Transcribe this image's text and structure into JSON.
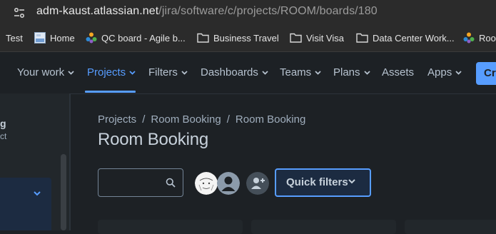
{
  "browser": {
    "url_domain": "adm-kaust.atlassian.net",
    "url_path": "/jira/software/c/projects/ROOM/boards/180",
    "bookmarks": [
      {
        "label": "Test",
        "icon": "none"
      },
      {
        "label": "Home",
        "icon": "page-thumbnail-icon"
      },
      {
        "label": "QC board - Agile b...",
        "icon": "jira-icon"
      },
      {
        "label": "Business Travel",
        "icon": "folder-icon"
      },
      {
        "label": "Visit Visa",
        "icon": "folder-icon"
      },
      {
        "label": "Data Center Work...",
        "icon": "folder-icon"
      },
      {
        "label": "Roo",
        "icon": "jira-icon"
      }
    ]
  },
  "nav": {
    "items": [
      {
        "label": "Your work"
      },
      {
        "label": "Projects"
      },
      {
        "label": "Filters"
      },
      {
        "label": "Dashboards"
      },
      {
        "label": "Teams"
      },
      {
        "label": "Plans"
      },
      {
        "label": "Assets"
      },
      {
        "label": "Apps"
      }
    ],
    "active": "Projects",
    "create_label": "Cr"
  },
  "sidebar": {
    "project_name_fragment": "g",
    "project_type_fragment": "ct"
  },
  "breadcrumb": [
    "Projects",
    "Room Booking",
    "Room Booking"
  ],
  "page_title": "Room Booking",
  "toolbar": {
    "search_value": "",
    "quick_filters_label": "Quick filters"
  },
  "colors": {
    "accent": "#579dff",
    "background": "#1d2125",
    "text": "#b6c2cf"
  }
}
